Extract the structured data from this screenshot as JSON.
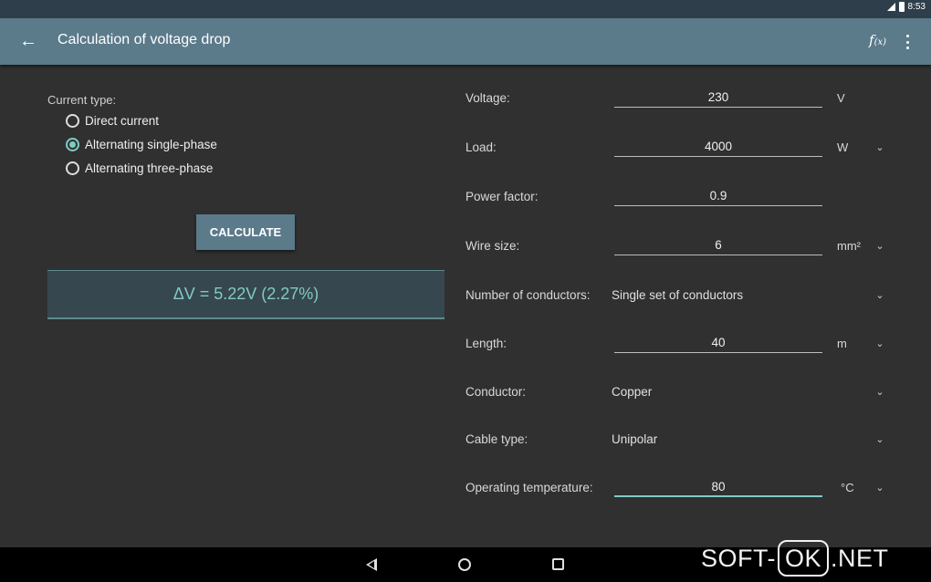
{
  "status_bar": {
    "time": "8:53"
  },
  "app_bar": {
    "title": "Calculation of voltage drop",
    "fx_label": "f",
    "fx_sub": "(x)"
  },
  "current_type": {
    "label": "Current type:",
    "options": [
      {
        "label": "Direct current",
        "checked": false
      },
      {
        "label": "Alternating single-phase",
        "checked": true
      },
      {
        "label": "Alternating three-phase",
        "checked": false
      }
    ]
  },
  "calculate_label": "CALCULATE",
  "result": "ΔV = 5.22V  (2.27%)",
  "fields": {
    "voltage": {
      "label": "Voltage:",
      "value": "230",
      "unit": "V"
    },
    "load": {
      "label": "Load:",
      "value": "4000",
      "unit": "W"
    },
    "power_factor": {
      "label": "Power factor:",
      "value": "0.9"
    },
    "wire_size": {
      "label": "Wire size:",
      "value": "6",
      "unit": "mm²"
    },
    "conductors": {
      "label": "Number of conductors:",
      "value": "Single set of conductors"
    },
    "length": {
      "label": "Length:",
      "value": "40",
      "unit": "m"
    },
    "conductor": {
      "label": "Conductor:",
      "value": "Copper"
    },
    "cable_type": {
      "label": "Cable type:",
      "value": "Unipolar"
    },
    "operating_temperature": {
      "label": "Operating temperature:",
      "value": "80",
      "unit": "°C"
    }
  },
  "watermark": {
    "left": "SOFT-",
    "ok": "OK",
    "right": ".NET"
  },
  "colors": {
    "app_bar": "#5b7a8a",
    "accent": "#80cbc4",
    "background": "#303030"
  },
  "icons": [
    "back-arrow-icon",
    "function-icon",
    "more-vert-icon",
    "chevron-down-icon",
    "nav-back-icon",
    "nav-home-icon",
    "nav-recents-icon"
  ]
}
